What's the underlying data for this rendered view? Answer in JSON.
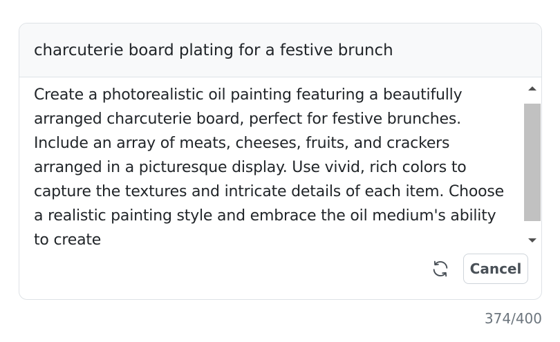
{
  "header": {
    "title": "charcuterie board plating for a festive brunch"
  },
  "prompt": {
    "text": "Create a photorealistic oil painting featuring a beautifully arranged charcuterie board, perfect for festive brunches. Include an array of meats, cheeses, fruits, and crackers arranged in a picturesque display. Use vivid, rich colors to capture the textures and intricate details of each item. Choose a realistic painting style and embrace the oil medium's ability to create"
  },
  "actions": {
    "refresh_icon": "refresh-icon",
    "cancel_label": "Cancel"
  },
  "counter": {
    "text": "374/400"
  },
  "colors": {
    "border": "#dee2e6",
    "header_bg": "#f8f9fa",
    "scroll_thumb": "#c1c1c1",
    "muted_text": "#6c757d"
  }
}
